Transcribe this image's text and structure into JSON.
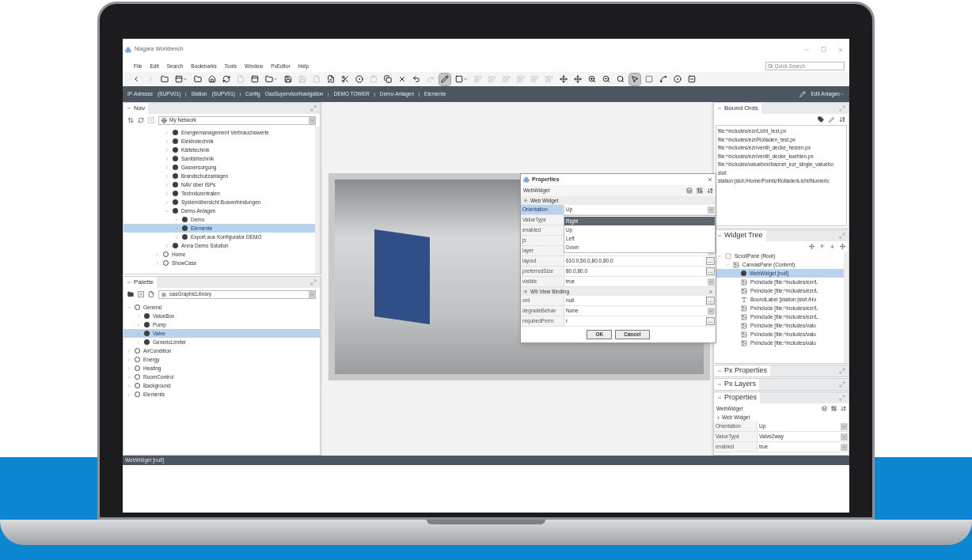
{
  "window": {
    "title": "Niagara Workbench"
  },
  "menu": [
    "File",
    "Edit",
    "Search",
    "Bookmarks",
    "Tools",
    "Window",
    "PxEditor",
    "Help"
  ],
  "quick_search": {
    "placeholder": "Quick Search"
  },
  "toolbar": [
    {
      "kind": "back",
      "selected": false,
      "disabled": false
    },
    {
      "kind": "forward",
      "selected": false,
      "disabled": true
    },
    {
      "kind": "folder",
      "selected": false,
      "disabled": false
    },
    {
      "kind": "panel-menu",
      "selected": false,
      "disabled": false
    },
    {
      "kind": "folder",
      "selected": false,
      "disabled": false
    },
    {
      "kind": "home",
      "selected": false,
      "disabled": false
    },
    {
      "kind": "refresh",
      "selected": false,
      "disabled": false
    },
    {
      "kind": "file",
      "selected": false,
      "disabled": true
    },
    {
      "kind": "panel",
      "selected": false,
      "disabled": false
    },
    {
      "kind": "folder-menu",
      "selected": false,
      "disabled": false
    },
    {
      "kind": "save",
      "selected": false,
      "disabled": false
    },
    {
      "kind": "save",
      "selected": false,
      "disabled": true
    },
    {
      "kind": "file",
      "selected": false,
      "disabled": true
    },
    {
      "kind": "file-edit",
      "selected": false,
      "disabled": false
    },
    {
      "kind": "cut",
      "selected": false,
      "disabled": false
    },
    {
      "kind": "target",
      "selected": false,
      "disabled": false
    },
    {
      "kind": "paste",
      "selected": false,
      "disabled": true
    },
    {
      "kind": "copy",
      "selected": false,
      "disabled": false
    },
    {
      "kind": "delete",
      "selected": false,
      "disabled": false
    },
    {
      "kind": "undo",
      "selected": false,
      "disabled": false
    },
    {
      "kind": "redo",
      "selected": false,
      "disabled": true
    },
    {
      "kind": "pencil",
      "selected": true,
      "disabled": false
    },
    {
      "kind": "square-menu",
      "selected": false,
      "disabled": false
    },
    {
      "kind": "align",
      "selected": false,
      "disabled": true
    },
    {
      "kind": "align",
      "selected": false,
      "disabled": true
    },
    {
      "kind": "align",
      "selected": false,
      "disabled": true
    },
    {
      "kind": "align",
      "selected": false,
      "disabled": true
    },
    {
      "kind": "align",
      "selected": false,
      "disabled": true
    },
    {
      "kind": "align",
      "selected": false,
      "disabled": true
    },
    {
      "kind": "move",
      "selected": false,
      "disabled": false
    },
    {
      "kind": "move",
      "selected": false,
      "disabled": false
    },
    {
      "kind": "zoom-in",
      "selected": false,
      "disabled": false
    },
    {
      "kind": "zoom-out",
      "selected": false,
      "disabled": false
    },
    {
      "kind": "zoom",
      "selected": false,
      "disabled": false
    },
    {
      "kind": "pointer",
      "selected": true,
      "disabled": false
    },
    {
      "kind": "select",
      "selected": false,
      "disabled": false
    },
    {
      "kind": "connector",
      "selected": false,
      "disabled": false
    },
    {
      "kind": "target",
      "selected": false,
      "disabled": false
    },
    {
      "kind": "stop",
      "selected": false,
      "disabled": false
    }
  ],
  "breadcrumb": {
    "items": [
      "IP-Adresse",
      "(SUPV01)",
      "Station",
      "(SUPV01)",
      "Config",
      "OasSupervisorNavigation",
      "DEMO TOWER",
      "Demo-Anlagen",
      "Elemente"
    ],
    "view": "Edit Anlagen"
  },
  "nav": {
    "title": "Nav",
    "source": "My Network",
    "tree": [
      {
        "children": [
          {
            "label": "Energiemanagement Verbrauchswerte",
            "kind": "point",
            "expanded": false,
            "selected": false
          },
          {
            "label": "Elektrotechnik",
            "kind": "point",
            "expanded": false,
            "selected": false
          },
          {
            "label": "Kältetechnik",
            "kind": "point",
            "expanded": false,
            "selected": false
          },
          {
            "label": "Sanitärtechnik",
            "kind": "point",
            "expanded": false,
            "selected": false
          },
          {
            "label": "Gasversorgung",
            "kind": "point",
            "expanded": false,
            "selected": false
          },
          {
            "label": "Brandschutzanlagen",
            "kind": "point",
            "expanded": false,
            "selected": false
          },
          {
            "label": "NAV über ISPs",
            "kind": "point",
            "expanded": false,
            "selected": false
          },
          {
            "label": "Technikzentralen",
            "kind": "point",
            "expanded": false,
            "selected": false
          },
          {
            "label": "Systemübersicht Busverbindungen",
            "kind": "point",
            "expanded": false,
            "selected": false
          },
          {
            "label": "Demo-Anlagen",
            "kind": "point",
            "expanded": true,
            "selected": false,
            "children": [
              {
                "label": "Demo",
                "kind": "point",
                "expanded": false,
                "selected": false
              },
              {
                "label": "Elemente",
                "kind": "point",
                "expanded": true,
                "selected": true
              },
              {
                "label": "Export aus Konfigurator DEMO",
                "kind": "point",
                "expanded": false,
                "selected": false
              }
            ]
          },
          {
            "label": "Anna Demo Solution",
            "kind": "point",
            "expanded": false,
            "selected": false
          }
        ]
      },
      {
        "label": "Home",
        "kind": "folder",
        "expanded": false,
        "selected": false
      },
      {
        "label": "ShowCase",
        "kind": "folder",
        "expanded": false,
        "selected": false
      }
    ]
  },
  "palette": {
    "title": "Palette",
    "library": "oasGraphicLibrary",
    "tree": [
      {
        "label": "General",
        "kind": "folder",
        "expanded": true,
        "selected": false,
        "children": [
          {
            "label": "ValueBox",
            "kind": "point",
            "expanded": false,
            "selected": false
          },
          {
            "label": "Pump",
            "kind": "point",
            "expanded": false,
            "selected": false
          },
          {
            "label": "Valve",
            "kind": "point",
            "expanded": false,
            "selected": true
          },
          {
            "label": "GenericLimiter",
            "kind": "point",
            "expanded": false,
            "selected": false
          }
        ]
      },
      {
        "label": "AirCondition",
        "kind": "folder",
        "expanded": false,
        "selected": false
      },
      {
        "label": "Energy",
        "kind": "folder",
        "expanded": false,
        "selected": false
      },
      {
        "label": "Heating",
        "kind": "folder",
        "expanded": false,
        "selected": false
      },
      {
        "label": "RoomControl",
        "kind": "folder",
        "expanded": false,
        "selected": false
      },
      {
        "label": "Background",
        "kind": "folder",
        "expanded": false,
        "selected": false
      },
      {
        "label": "Elements",
        "kind": "folder",
        "expanded": false,
        "selected": false
      }
    ]
  },
  "properties_dialog": {
    "title": "Properties",
    "object": "WebWidget",
    "sections": [
      {
        "title": "Web Widget",
        "rows": [
          {
            "name": "Orientation",
            "value": "Up",
            "kind": "dropdown",
            "selected": true
          },
          {
            "name": "ValueType",
            "kind": "hidden",
            "selected": false
          },
          {
            "name": "enabled",
            "kind": "hidden",
            "selected": false
          },
          {
            "name": "js",
            "kind": "hidden",
            "selected": false
          },
          {
            "name": "layer",
            "kind": "dropdown",
            "selected": false
          },
          {
            "name": "layout",
            "value": "610.0,50.0,80.0,80.0",
            "kind": "ellipsis",
            "button": "...",
            "selected": false
          },
          {
            "name": "preferredSize",
            "value": "80.0,80.0",
            "kind": "ellipsis",
            "button": "...",
            "selected": false
          },
          {
            "name": "visible",
            "value": "true",
            "kind": "dropdown",
            "selected": false
          }
        ]
      },
      {
        "title": "Wb View Binding",
        "closable": true,
        "rows": [
          {
            "name": "ord",
            "value": "null",
            "kind": "ellipsis",
            "button": "...",
            "selected": false
          },
          {
            "name": "degradeBehav",
            "value": "None",
            "kind": "dropdown",
            "selected": false
          },
          {
            "name": "requiredPerm",
            "value": "r",
            "kind": "ellipsis",
            "button": "...",
            "selected": false
          }
        ]
      }
    ],
    "dropdown_options": [
      {
        "label": "Right",
        "selected": true
      },
      {
        "label": "Up",
        "selected": false
      },
      {
        "label": "Left",
        "selected": false
      },
      {
        "label": "Down",
        "selected": false
      }
    ],
    "buttons": [
      "OK",
      "Cancel"
    ]
  },
  "bound_ords": {
    "title": "Bound Ords",
    "items": [
      "file:^includes/ezr/Licht_test.px",
      "file:^includes/ezr/Rolladen_test.px",
      "file:^includes/ezr/ventil_decke_heizen.px",
      "file:^includes/ezr/ventil_decke_kuehlen.px",
      "file:^includes/valuebox/bacnet_ezr_single_valuebo",
      "slot:",
      "station:|slot:/Home/Points/RolladenLicht/Numeric"
    ]
  },
  "widget_tree": {
    "title": "Widget Tree",
    "tree": [
      {
        "label": "ScrollPane (Root)",
        "kind": "frame",
        "expanded": true,
        "selected": false,
        "children": [
          {
            "label": "CanvasPane (Content)",
            "kind": "canvas",
            "expanded": true,
            "selected": false,
            "children": [
              {
                "label": "WebWidget [null]",
                "kind": "point",
                "selected": true
              },
              {
                "label": "PxInclude [file:^includes/ezr/L",
                "kind": "px",
                "selected": false
              },
              {
                "label": "PxInclude [file:^includes/ezr/L",
                "kind": "px",
                "selected": false
              },
              {
                "label": "BoundLabel [station:|slot:/Ho",
                "kind": "label",
                "selected": false
              },
              {
                "label": "PxInclude [file:^includes/ezr/L",
                "kind": "px",
                "selected": false
              },
              {
                "label": "PxInclude [file:^includes/ezr/L",
                "kind": "px",
                "selected": false
              },
              {
                "label": "PxInclude [file:^includes/valu",
                "kind": "px",
                "selected": false
              },
              {
                "label": "PxInclude [file:^includes/valu",
                "kind": "px",
                "selected": false
              },
              {
                "label": "PxInclude [file:^includes/valu",
                "kind": "px",
                "selected": false
              }
            ]
          }
        ]
      }
    ]
  },
  "collapsed_panels": [
    {
      "title": "Px Properties"
    },
    {
      "title": "Px Layers"
    }
  ],
  "properties_panel": {
    "title": "Properties",
    "object": "WebWidget",
    "section": "Web Widget",
    "rows": [
      {
        "name": "Orientation",
        "value": "Up"
      },
      {
        "name": "ValueType",
        "value": "Valve2way"
      },
      {
        "name": "enabled",
        "value": "true"
      }
    ]
  },
  "status_bar": {
    "text": "WebWidget [null]"
  }
}
